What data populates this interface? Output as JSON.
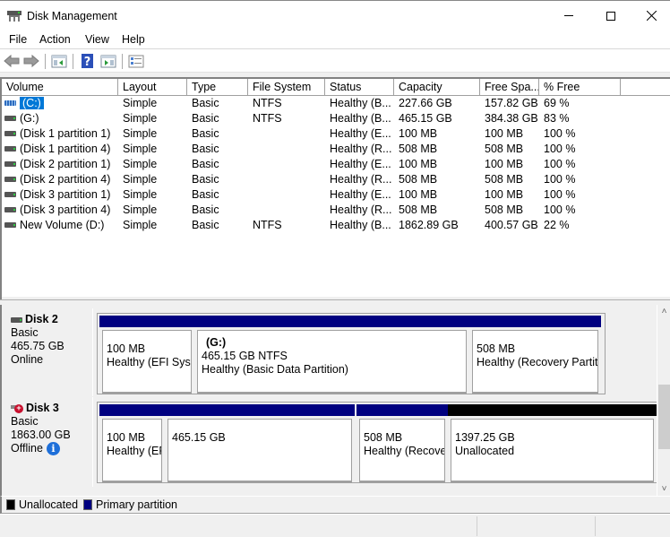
{
  "window": {
    "title": "Disk Management",
    "controls": {
      "minimize": "minimize",
      "maximize": "maximize",
      "close": "close"
    }
  },
  "menu": {
    "items": [
      "File",
      "Action",
      "View",
      "Help"
    ]
  },
  "toolbar": {
    "buttons": [
      "back-arrow-icon",
      "forward-arrow-icon",
      "show-hide-console-tree-icon",
      "help-icon",
      "show-hide-action-pane-icon",
      "properties-icon"
    ]
  },
  "volume_list": {
    "columns": [
      "Volume",
      "Layout",
      "Type",
      "File System",
      "Status",
      "Capacity",
      "Free Spa...",
      "% Free"
    ],
    "rows": [
      {
        "volume": "(C:)",
        "layout": "Simple",
        "type": "Basic",
        "fs": "NTFS",
        "status": "Healthy (B...",
        "capacity": "227.66 GB",
        "free": "157.82 GB",
        "pct": "69 %",
        "selected": true,
        "icon": "system-volume-icon"
      },
      {
        "volume": "(G:)",
        "layout": "Simple",
        "type": "Basic",
        "fs": "NTFS",
        "status": "Healthy (B...",
        "capacity": "465.15 GB",
        "free": "384.38 GB",
        "pct": "83 %",
        "selected": false,
        "icon": "volume-icon"
      },
      {
        "volume": "(Disk 1 partition 1)",
        "layout": "Simple",
        "type": "Basic",
        "fs": "",
        "status": "Healthy (E...",
        "capacity": "100 MB",
        "free": "100 MB",
        "pct": "100 %",
        "selected": false,
        "icon": "volume-icon"
      },
      {
        "volume": "(Disk 1 partition 4)",
        "layout": "Simple",
        "type": "Basic",
        "fs": "",
        "status": "Healthy (R...",
        "capacity": "508 MB",
        "free": "508 MB",
        "pct": "100 %",
        "selected": false,
        "icon": "volume-icon"
      },
      {
        "volume": "(Disk 2 partition 1)",
        "layout": "Simple",
        "type": "Basic",
        "fs": "",
        "status": "Healthy (E...",
        "capacity": "100 MB",
        "free": "100 MB",
        "pct": "100 %",
        "selected": false,
        "icon": "volume-icon"
      },
      {
        "volume": "(Disk 2 partition 4)",
        "layout": "Simple",
        "type": "Basic",
        "fs": "",
        "status": "Healthy (R...",
        "capacity": "508 MB",
        "free": "508 MB",
        "pct": "100 %",
        "selected": false,
        "icon": "volume-icon"
      },
      {
        "volume": "(Disk 3 partition 1)",
        "layout": "Simple",
        "type": "Basic",
        "fs": "",
        "status": "Healthy (E...",
        "capacity": "100 MB",
        "free": "100 MB",
        "pct": "100 %",
        "selected": false,
        "icon": "volume-icon"
      },
      {
        "volume": "(Disk 3 partition 4)",
        "layout": "Simple",
        "type": "Basic",
        "fs": "",
        "status": "Healthy (R...",
        "capacity": "508 MB",
        "free": "508 MB",
        "pct": "100 %",
        "selected": false,
        "icon": "volume-icon"
      },
      {
        "volume": "New Volume (D:)",
        "layout": "Simple",
        "type": "Basic",
        "fs": "NTFS",
        "status": "Healthy (B...",
        "capacity": "1862.89 GB",
        "free": "400.57 GB",
        "pct": "22 %",
        "selected": false,
        "icon": "volume-icon"
      }
    ]
  },
  "disks": [
    {
      "name": "Disk 2",
      "type": "Basic",
      "size": "465.75 GB",
      "state": "Online",
      "offline": false,
      "partitions": [
        {
          "title": "",
          "line1": "100 MB",
          "line2": "Healthy (EFI Syste",
          "kind": "primary"
        },
        {
          "title": "(G:)",
          "line1": "465.15 GB NTFS",
          "line2": "Healthy (Basic Data Partition)",
          "kind": "primary"
        },
        {
          "title": "",
          "line1": "508 MB",
          "line2": "Healthy (Recovery Partitio",
          "kind": "primary"
        }
      ]
    },
    {
      "name": "Disk 3",
      "type": "Basic",
      "size": "1863.00 GB",
      "state": "Offline",
      "offline": true,
      "partitions": [
        {
          "title": "",
          "line1": "100 MB",
          "line2": "Healthy (EF",
          "kind": "primary"
        },
        {
          "title": "",
          "line1": "465.15 GB",
          "line2": "",
          "kind": "primary"
        },
        {
          "title": "",
          "line1": "508 MB",
          "line2": "Healthy (Recove",
          "kind": "primary"
        },
        {
          "title": "",
          "line1": "1397.25 GB",
          "line2": "Unallocated",
          "kind": "unallocated"
        }
      ]
    }
  ],
  "legend": {
    "items": [
      {
        "label": "Unallocated",
        "color": "#000000"
      },
      {
        "label": "Primary partition",
        "color": "#000080"
      }
    ]
  },
  "colors": {
    "primary_partition": "#000080",
    "unallocated": "#000000",
    "selection": "#0078d7"
  }
}
